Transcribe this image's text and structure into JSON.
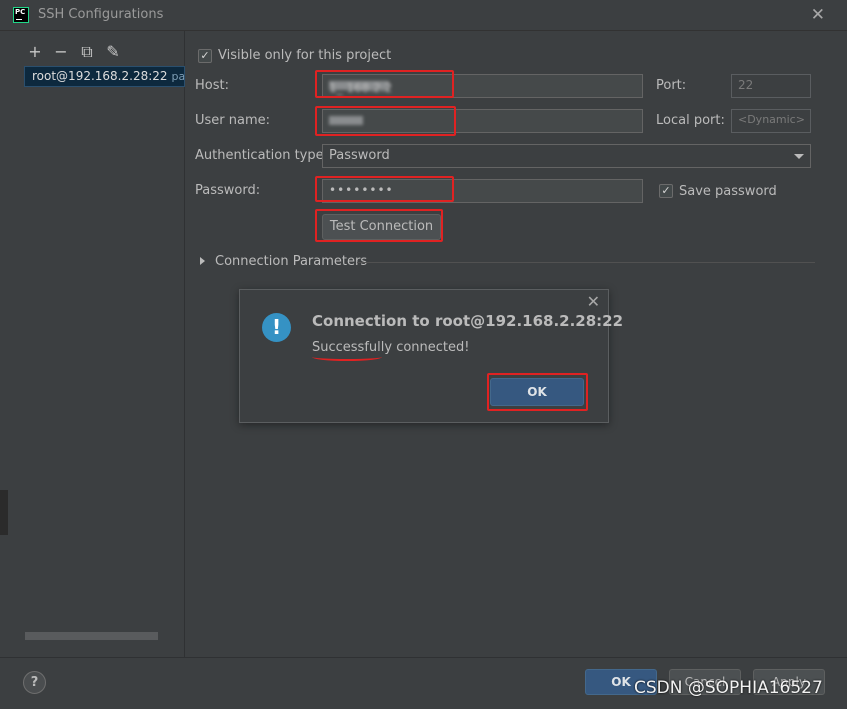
{
  "window": {
    "title": "SSH Configurations",
    "app_logo": "PC"
  },
  "toolbar": {
    "add": "+",
    "remove": "−",
    "copy": "⧉",
    "edit": "✎"
  },
  "config_list": [
    {
      "name": "root@192.168.2.28:22",
      "auth": "pass"
    }
  ],
  "form": {
    "visible_only_label": "Visible only for this project",
    "host_label": "Host:",
    "host_value": "1_ 168.2.2",
    "port_label": "Port:",
    "port_value": "22",
    "username_label": "User name:",
    "local_port_label": "Local port:",
    "local_port_placeholder": "<Dynamic>",
    "auth_type_label": "Authentication type:",
    "auth_type_value": "Password",
    "password_label": "Password:",
    "password_value": "••••••••",
    "save_password_label": "Save password",
    "test_connection": "Test Connection",
    "connection_params": "Connection Parameters"
  },
  "dialog": {
    "icon": "!",
    "title": "Connection to root@192.168.2.28:22",
    "message": "Successfully connected!",
    "ok": "OK",
    "close": "✕"
  },
  "footer": {
    "help": "?",
    "ok": "OK",
    "cancel": "Cancel",
    "apply": "Apply",
    "watermark": "CSDN @SOPHIA16527"
  },
  "colors": {
    "accent": "#365880",
    "highlight": "#e02222"
  }
}
